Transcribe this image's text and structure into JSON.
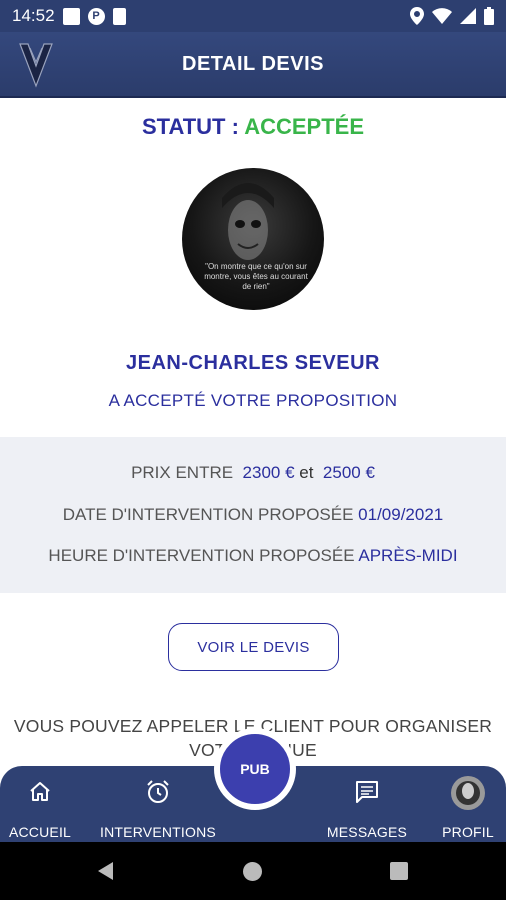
{
  "status_bar": {
    "time": "14:52"
  },
  "header": {
    "title": "DETAIL DEVIS"
  },
  "statut": {
    "label": "STATUT :",
    "value": "ACCEPTÉE"
  },
  "client": {
    "name": "JEAN-CHARLES  SEVEUR",
    "message": "A ACCEPTÉ VOTRE PROPOSITION",
    "avatar_quote": "\"On montre que ce qu'on sur montre, vous êtes au courant de rien\""
  },
  "details": {
    "price_label": "PRIX ENTRE",
    "price_min": "2300 €",
    "price_and": "et",
    "price_max": "2500 €",
    "date_label": "DATE D'INTERVENTION PROPOSÉE",
    "date_value": "01/09/2021",
    "time_label": "HEURE D'INTERVENTION PROPOSÉE",
    "time_value": "APRÈS-MIDI"
  },
  "button_voir_devis": "VOIR LE DEVIS",
  "note": "VOUS POUVEZ APPELER LE CLIENT POUR ORGANISER VOTRE VENUE",
  "nav": {
    "accueil": "ACCUEIL",
    "interventions": "INTERVENTIONS",
    "pub": "PUB",
    "messages": "MESSAGES",
    "profil": "PROFIL"
  },
  "colors": {
    "primary": "#2f4173",
    "accent_text": "#2b2f9e",
    "success": "#39b54a"
  }
}
